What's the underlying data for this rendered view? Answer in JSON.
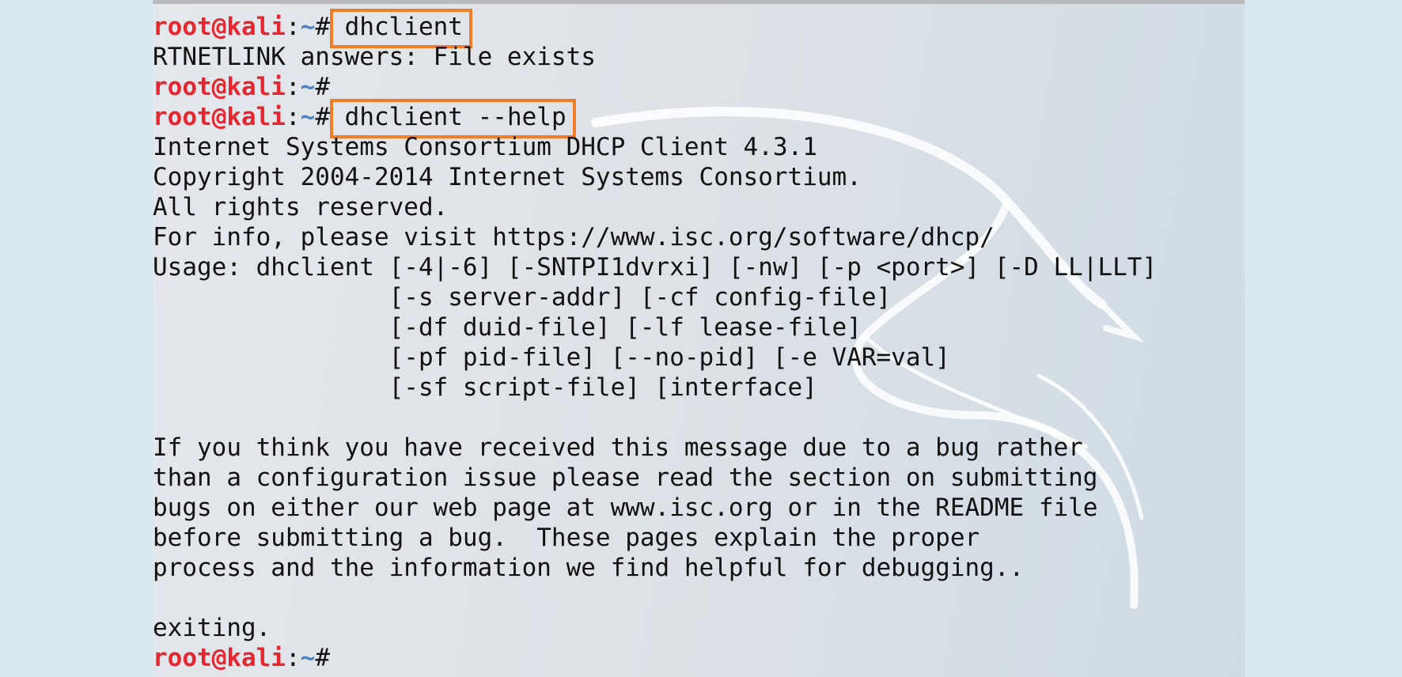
{
  "prompt": {
    "user": "root@kali",
    "sep": ":",
    "path": "~",
    "symbol": "#"
  },
  "colors": {
    "prompt_user": "#e8262f",
    "prompt_path": "#4f82c2",
    "highlight_box": "#f07e26",
    "text": "#111111"
  },
  "terminal": {
    "lines": [
      {
        "type": "prompt",
        "cmd": " dhclient",
        "highlight": true
      },
      {
        "type": "output",
        "text": "RTNETLINK answers: File exists"
      },
      {
        "type": "prompt",
        "cmd": ""
      },
      {
        "type": "prompt",
        "cmd": " dhclient --help",
        "highlight": true
      },
      {
        "type": "output",
        "text": "Internet Systems Consortium DHCP Client 4.3.1"
      },
      {
        "type": "output",
        "text": "Copyright 2004-2014 Internet Systems Consortium."
      },
      {
        "type": "output",
        "text": "All rights reserved."
      },
      {
        "type": "output",
        "text": "For info, please visit https://www.isc.org/software/dhcp/"
      },
      {
        "type": "output",
        "text": "Usage: dhclient [-4|-6] [-SNTPI1dvrxi] [-nw] [-p <port>] [-D LL|LLT]"
      },
      {
        "type": "output",
        "text": "                [-s server-addr] [-cf config-file]"
      },
      {
        "type": "output",
        "text": "                [-df duid-file] [-lf lease-file]"
      },
      {
        "type": "output",
        "text": "                [-pf pid-file] [--no-pid] [-e VAR=val]"
      },
      {
        "type": "output",
        "text": "                [-sf script-file] [interface]"
      },
      {
        "type": "output",
        "text": ""
      },
      {
        "type": "output",
        "text": "If you think you have received this message due to a bug rather"
      },
      {
        "type": "output",
        "text": "than a configuration issue please read the section on submitting"
      },
      {
        "type": "output",
        "text": "bugs on either our web page at www.isc.org or in the README file"
      },
      {
        "type": "output",
        "text": "before submitting a bug.  These pages explain the proper"
      },
      {
        "type": "output",
        "text": "process and the information we find helpful for debugging.."
      },
      {
        "type": "output",
        "text": ""
      },
      {
        "type": "output",
        "text": "exiting."
      },
      {
        "type": "prompt",
        "cmd": ""
      }
    ]
  }
}
